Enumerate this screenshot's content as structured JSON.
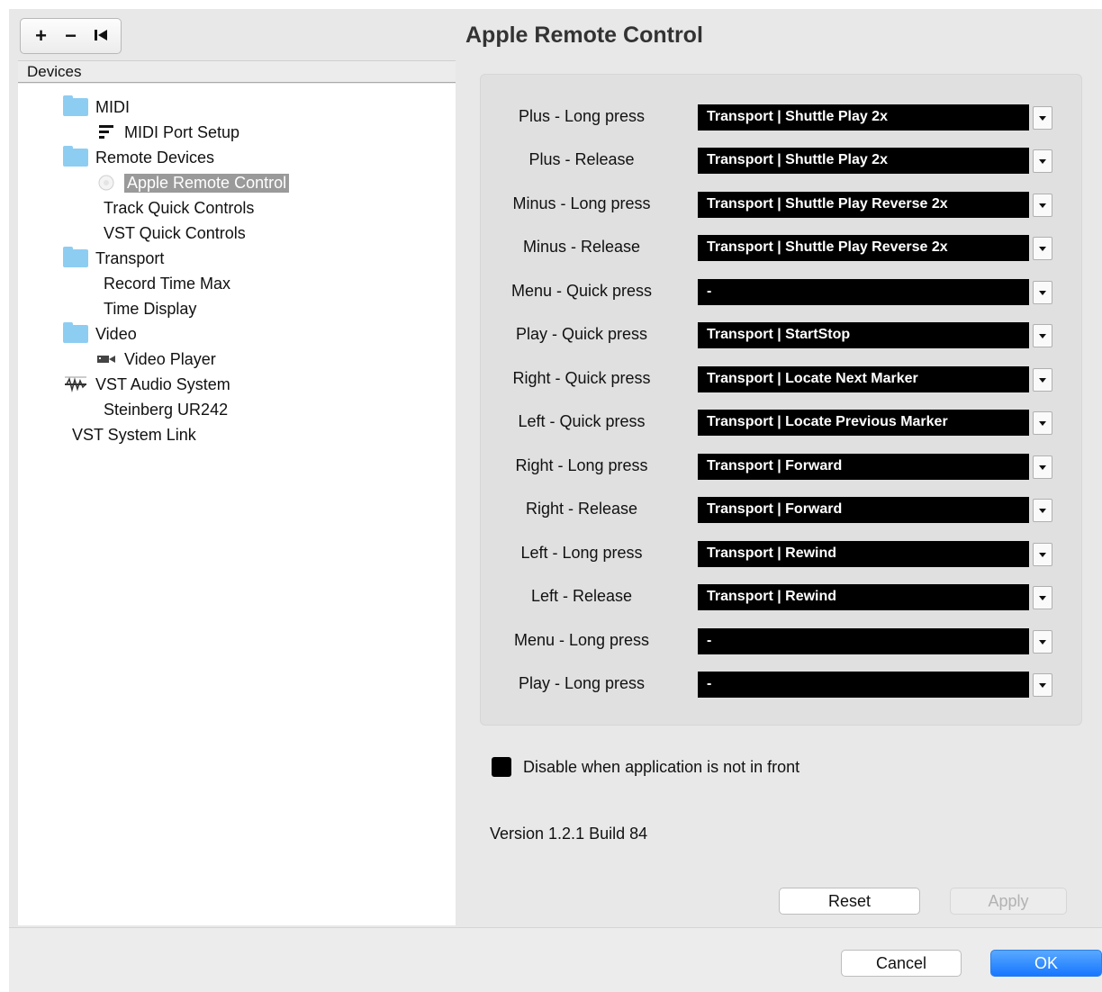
{
  "toolbar": {
    "add_label": "+",
    "remove_label": "−",
    "reset_label": "I◀"
  },
  "devices": {
    "header": "Devices",
    "items": [
      {
        "label": "MIDI",
        "icon": "folder-icon"
      },
      {
        "label": "MIDI Port Setup",
        "icon": "midi-port-icon"
      },
      {
        "label": "Remote Devices",
        "icon": "folder-icon"
      },
      {
        "label": "Apple Remote Control",
        "icon": "apple-remote-icon",
        "selected": true
      },
      {
        "label": "Track Quick Controls"
      },
      {
        "label": "VST Quick Controls"
      },
      {
        "label": "Transport",
        "icon": "folder-icon"
      },
      {
        "label": "Record Time Max"
      },
      {
        "label": "Time Display"
      },
      {
        "label": "Video",
        "icon": "folder-icon"
      },
      {
        "label": "Video Player",
        "icon": "video-player-icon"
      },
      {
        "label": "VST Audio System",
        "icon": "audio-system-icon"
      },
      {
        "label": "Steinberg UR242"
      },
      {
        "label": "VST System Link"
      }
    ]
  },
  "panel": {
    "title": "Apple Remote Control",
    "mappings": [
      {
        "label": "Plus - Long press",
        "value": "Transport | Shuttle Play 2x"
      },
      {
        "label": "Plus - Release",
        "value": "Transport | Shuttle Play 2x"
      },
      {
        "label": "Minus - Long press",
        "value": "Transport | Shuttle Play Reverse 2x"
      },
      {
        "label": "Minus - Release",
        "value": "Transport | Shuttle Play Reverse 2x"
      },
      {
        "label": "Menu - Quick press",
        "value": "-"
      },
      {
        "label": "Play - Quick press",
        "value": "Transport | StartStop"
      },
      {
        "label": "Right - Quick press",
        "value": "Transport | Locate Next Marker"
      },
      {
        "label": "Left - Quick press",
        "value": "Transport | Locate Previous Marker"
      },
      {
        "label": "Right - Long press",
        "value": "Transport | Forward"
      },
      {
        "label": "Right - Release",
        "value": "Transport | Forward"
      },
      {
        "label": "Left - Long press",
        "value": "Transport | Rewind"
      },
      {
        "label": "Left - Release",
        "value": "Transport | Rewind"
      },
      {
        "label": "Menu - Long press",
        "value": "-"
      },
      {
        "label": "Play - Long press",
        "value": "-"
      }
    ],
    "disable_label": "Disable when application is not in front",
    "disable_checked": true,
    "version": "Version 1.2.1 Build 84",
    "reset_label": "Reset",
    "apply_label": "Apply"
  },
  "footer": {
    "cancel_label": "Cancel",
    "ok_label": "OK"
  },
  "colors": {
    "accent": "#1677ff",
    "selection": "#9a9a9a",
    "folder": "#8ecdf2",
    "value_bg": "#000000"
  }
}
